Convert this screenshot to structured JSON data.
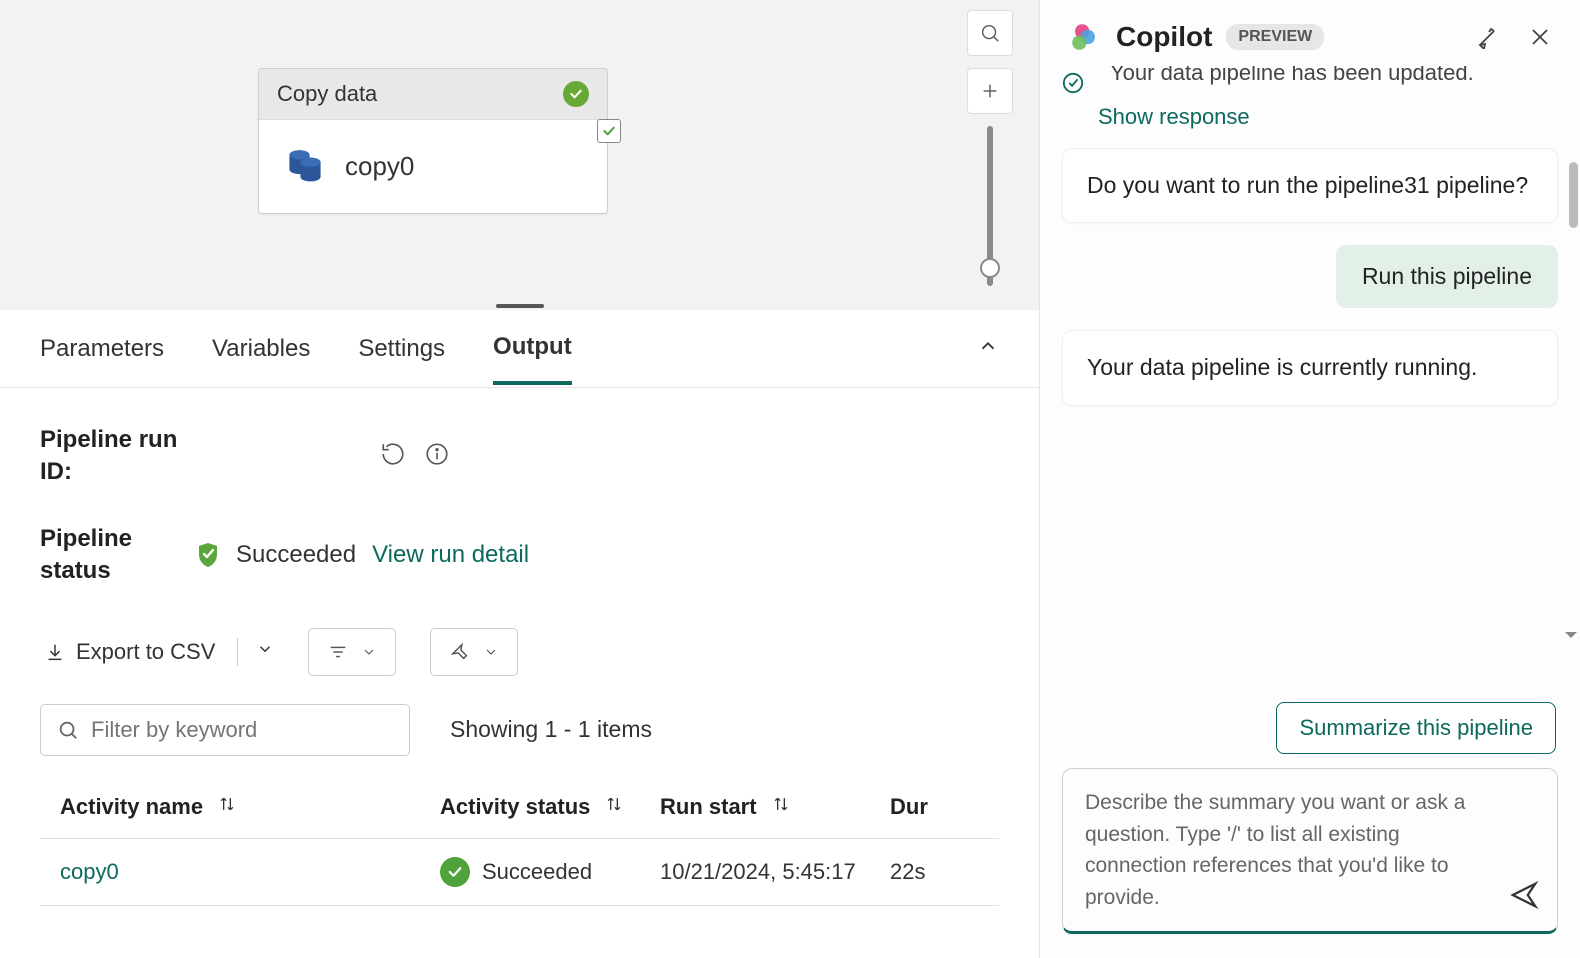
{
  "canvas": {
    "activity_type": "Copy data",
    "activity_name": "copy0"
  },
  "tabs": {
    "parameters": "Parameters",
    "variables": "Variables",
    "settings": "Settings",
    "output": "Output"
  },
  "output": {
    "run_id_label": "Pipeline run ID:",
    "status_label": "Pipeline status",
    "status_value": "Succeeded",
    "view_detail": "View run detail",
    "export_csv": "Export to CSV",
    "filter_placeholder": "Filter by keyword",
    "showing_text": "Showing 1 - 1 items",
    "columns": {
      "name": "Activity name",
      "status": "Activity status",
      "start": "Run start",
      "duration": "Dur"
    },
    "rows": [
      {
        "name": "copy0",
        "status": "Succeeded",
        "start": "10/21/2024, 5:45:17",
        "duration": "22s"
      }
    ]
  },
  "copilot": {
    "title": "Copilot",
    "badge": "PREVIEW",
    "partial_message": "Your data pipeline has been updated.",
    "show_response": "Show response",
    "messages": {
      "m1": "Do you want to run the pipeline31 pipeline?",
      "user1": "Run this pipeline",
      "m2": "Your data pipeline is currently running."
    },
    "suggestion": "Summarize this pipeline",
    "input_placeholder": "Describe the summary you want or ask a question.\nType '/' to list all existing connection references that you'd like to provide."
  }
}
